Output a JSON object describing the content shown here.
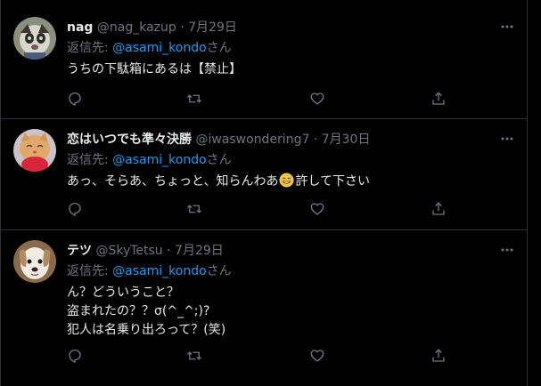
{
  "tweets": [
    {
      "name": "nag",
      "handle": "@nag_kazup",
      "separator": "·",
      "date": "7月29日",
      "reply_prefix": "返信先: ",
      "reply_to": "@asami_kondo",
      "reply_suffix": "さん",
      "lines": [
        "うちの下駄箱にあるは【禁止】"
      ]
    },
    {
      "name": "恋はいつでも準々決勝",
      "handle": "@iwaswondering7",
      "separator": "·",
      "date": "7月30日",
      "reply_prefix": "返信先: ",
      "reply_to": "@asami_kondo",
      "reply_suffix": "さん",
      "text_before_emoji": "あっ、そらあ、ちょっと、知らんわあ",
      "emoji_name": "grinning-sweat-emoji",
      "text_after_emoji": "許して下さい"
    },
    {
      "name": "テツ",
      "handle": "@SkyTetsu",
      "separator": "·",
      "date": "7月29日",
      "reply_prefix": "返信先: ",
      "reply_to": "@asami_kondo",
      "reply_suffix": "さん",
      "lines": [
        "ん？どういうこと？",
        "盗まれたの？？σ(^_^;)?",
        "犯人は名乗り出ろって？(笑)"
      ]
    }
  ],
  "icons": {
    "more": "more-icon",
    "reply": "reply-icon",
    "retweet": "retweet-icon",
    "like": "heart-icon",
    "share": "share-icon"
  },
  "colors": {
    "background": "#000000",
    "text": "#e7e9ea",
    "muted": "#71767b",
    "link": "#1d9bf0",
    "divider": "#2f3336"
  }
}
